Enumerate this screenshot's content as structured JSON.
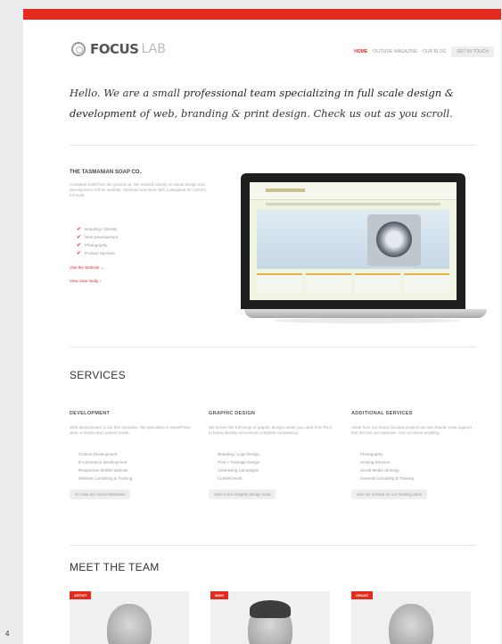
{
  "header": {
    "logo_text": "FOCUS",
    "logo_sub": "LAB",
    "nav": {
      "home": "HOME",
      "item2": "OUTSIDE MAGAZINE",
      "item3": "OUR BLOG",
      "button": "GET IN TOUCH"
    }
  },
  "intro": {
    "line1_a": "Hello. We are a small ",
    "line1_em": "professional team specializing in full scale design & development",
    "line2": " of web, branding & print design. Check us out as you scroll."
  },
  "case_study": {
    "title": "THE TASMANIAN SOAP CO.",
    "description": "Complete build from the ground up. We worked closely on visual design and development of their website, checkout and store with a designed ID Uniform full style.",
    "checks": [
      "Branding / Identity",
      "Web Development",
      "Photography",
      "Product Specials"
    ],
    "link1": "Visit the Website →",
    "link2": "View case study ›"
  },
  "services": {
    "title": "SERVICES",
    "items": [
      {
        "heading": "DEVELOPMENT",
        "description": "Web development is our first discipline. We specialise in WordPress sites, e-Stores and custom builds.",
        "list": [
          "Custom Development",
          "E-Commerce Development",
          "Responsive Mobile Website",
          "Website Consulting & Training"
        ],
        "button": "Or view our recent Websites"
      },
      {
        "heading": "GRAPHIC DESIGN",
        "description": "We deliver the full range of graphic design needs you need from Print to brand identity and ensure complete consistency.",
        "list": [
          "Branding / Logo Design",
          "Print + Package Design",
          "Advertising Campaigns",
          "Content Work"
        ],
        "button": "View more Graphic design work"
      },
      {
        "heading": "ADDITIONAL SERVICES",
        "description": "Aside from our brand focused projects we also handle extra support that the hits our expertise. Get out about anything.",
        "list": [
          "Photography",
          "Hosting Services",
          "Social Media Strategy",
          "General Consulting & Training"
        ],
        "button": "See our service on our hosting plans"
      }
    ]
  },
  "team": {
    "title": "MEET THE TEAM",
    "members": [
      {
        "tag": "ARTIST"
      },
      {
        "tag": "MIKE"
      },
      {
        "tag": "GRANT"
      }
    ]
  },
  "page_number": "4"
}
